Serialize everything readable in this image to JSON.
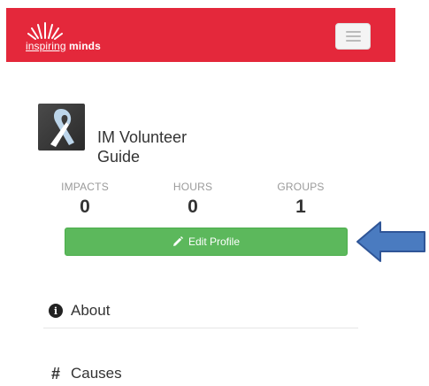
{
  "navbar": {
    "logo_text_thin": "inspiring",
    "logo_text_bold": "minds",
    "menu_button_icon": "hamburger-icon",
    "background_color": "#e4283b"
  },
  "profile": {
    "avatar_icon": "awareness-ribbon-icon",
    "name_line1": "IM Volunteer",
    "name_line2": "Guide"
  },
  "stats": [
    {
      "label": "IMPACTS",
      "value": "0"
    },
    {
      "label": "HOURS",
      "value": "0"
    },
    {
      "label": "GROUPS",
      "value": "1"
    }
  ],
  "edit_profile": {
    "label": "Edit Profile",
    "icon": "pencil-icon",
    "color": "#5cb85c"
  },
  "annotation": {
    "icon": "left-arrow-icon",
    "color": "#4a7bc0"
  },
  "menu": [
    {
      "label": "About",
      "icon": "info-circle-icon"
    },
    {
      "label": "Causes",
      "icon": "hashtag-icon"
    }
  ]
}
